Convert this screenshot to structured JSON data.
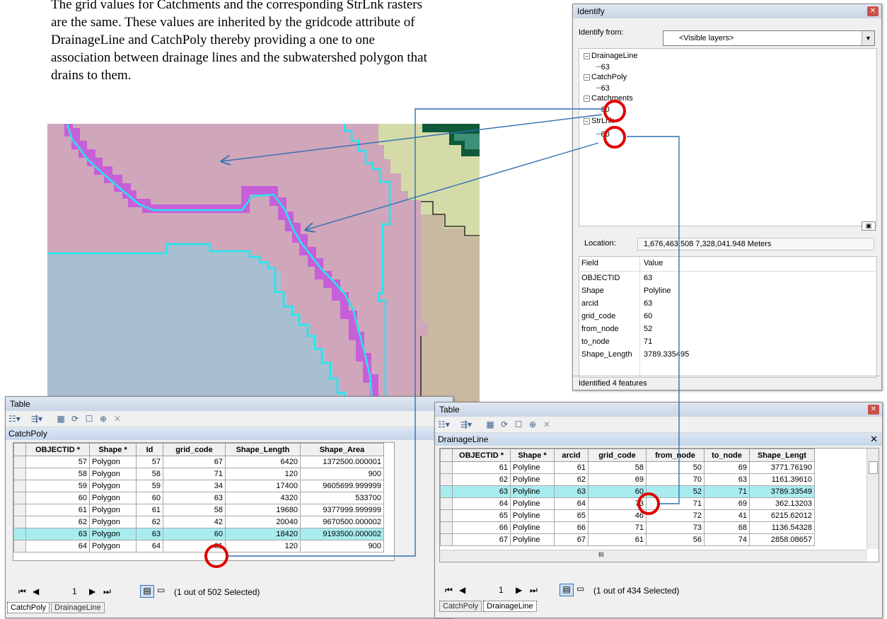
{
  "doc": {
    "line1": "The grid values for Catchments and the corresponding StrLnk rasters",
    "line2": "are the same.  These values are inherited by the gridcode attribute of",
    "line3": "DrainageLine and CatchPoly thereby providing a one to one",
    "line4": "association between drainage lines and the subwatershed polygon that",
    "line5": "drains to them."
  },
  "identify": {
    "title": "Identify",
    "from_label": "Identify from:",
    "from_value": "<Visible layers>",
    "tree": [
      {
        "layer": "DrainageLine",
        "value": "63"
      },
      {
        "layer": "CatchPoly",
        "value": "63"
      },
      {
        "layer": "Catchments",
        "value": "60"
      },
      {
        "layer": "StrLnk",
        "value": "60"
      }
    ],
    "location_label": "Location:",
    "location_value": "1,676,463.508  7,328,041.948 Meters",
    "field_header": "Field",
    "value_header": "Value",
    "fields": [
      {
        "field": "OBJECTID",
        "value": "63"
      },
      {
        "field": "Shape",
        "value": "Polyline"
      },
      {
        "field": "arcid",
        "value": "63"
      },
      {
        "field": "grid_code",
        "value": "60"
      },
      {
        "field": "from_node",
        "value": "52"
      },
      {
        "field": "to_node",
        "value": "71"
      },
      {
        "field": "Shape_Length",
        "value": "3789.335495"
      }
    ],
    "status": "Identified 4 features"
  },
  "table1": {
    "title": "Table",
    "name": "CatchPoly",
    "columns": [
      "OBJECTID *",
      "Shape *",
      "Id",
      "grid_code",
      "Shape_Length",
      "Shape_Area"
    ],
    "rows": [
      [
        "57",
        "Polygon",
        "57",
        "67",
        "6420",
        "1372500.000001"
      ],
      [
        "58",
        "Polygon",
        "58",
        "71",
        "120",
        "900"
      ],
      [
        "59",
        "Polygon",
        "59",
        "34",
        "17400",
        "9605699.999999"
      ],
      [
        "60",
        "Polygon",
        "60",
        "63",
        "4320",
        "533700"
      ],
      [
        "61",
        "Polygon",
        "61",
        "58",
        "19680",
        "9377999.999999"
      ],
      [
        "62",
        "Polygon",
        "62",
        "42",
        "20040",
        "9670500.000002"
      ],
      [
        "63",
        "Polygon",
        "63",
        "60",
        "18420",
        "9193500.000002"
      ],
      [
        "64",
        "Polygon",
        "64",
        "61",
        "120",
        "900"
      ]
    ],
    "page": "1",
    "selected": "(1 out of 502 Selected)",
    "tabs": [
      "CatchPoly",
      "DrainageLine"
    ]
  },
  "table2": {
    "title": "Table",
    "name": "DrainageLine",
    "columns": [
      "OBJECTID *",
      "Shape *",
      "arcid",
      "grid_code",
      "from_node",
      "to_node",
      "Shape_Lengt"
    ],
    "rows": [
      [
        "61",
        "Polyline",
        "61",
        "58",
        "50",
        "69",
        "3771.76190"
      ],
      [
        "62",
        "Polyline",
        "62",
        "69",
        "70",
        "63",
        "1161.39610"
      ],
      [
        "63",
        "Polyline",
        "63",
        "60",
        "52",
        "71",
        "3789.33549"
      ],
      [
        "64",
        "Polyline",
        "64",
        "73",
        "71",
        "69",
        "362.13203"
      ],
      [
        "65",
        "Polyline",
        "65",
        "46",
        "72",
        "41",
        "6215.62012"
      ],
      [
        "66",
        "Polyline",
        "66",
        "71",
        "73",
        "68",
        "1136.54328"
      ],
      [
        "67",
        "Polyline",
        "67",
        "61",
        "56",
        "74",
        "2858.08657"
      ]
    ],
    "page": "1",
    "selected": "(1 out of 434 Selected)",
    "tabs": [
      "CatchPoly",
      "DrainageLine"
    ],
    "hscroll_mark": "III"
  },
  "colors": {
    "pink": "#cfa6ba",
    "blue": "#a8bfd0",
    "tan": "#c9b9a1",
    "yellowgreen": "#d4dba8",
    "darkgreen": "#0f5a3a",
    "purple": "#c75fd9",
    "cyan": "#22e6f0",
    "annotation": "#2f6fb4",
    "circle": "#e00000",
    "highlight": "#a8ecf0"
  }
}
